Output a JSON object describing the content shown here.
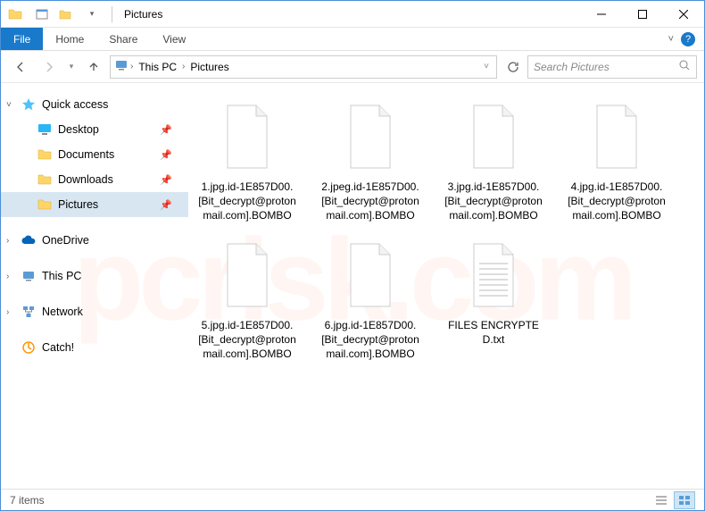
{
  "window": {
    "title": "Pictures",
    "minimize": "—",
    "maximize": "☐",
    "close": "✕"
  },
  "ribbon": {
    "file": "File",
    "home": "Home",
    "share": "Share",
    "view": "View",
    "expand_tip": "^"
  },
  "breadcrumb": {
    "root": "This PC",
    "current": "Pictures"
  },
  "search": {
    "placeholder": "Search Pictures"
  },
  "sidebar": {
    "quick_access": "Quick access",
    "quick_items": [
      {
        "label": "Desktop",
        "icon": "desktop"
      },
      {
        "label": "Documents",
        "icon": "folder"
      },
      {
        "label": "Downloads",
        "icon": "folder"
      },
      {
        "label": "Pictures",
        "icon": "folder"
      }
    ],
    "onedrive": "OneDrive",
    "this_pc": "This PC",
    "network": "Network",
    "catch": "Catch!"
  },
  "files": [
    {
      "name": "1.jpg.id-1E857D00.[Bit_decrypt@protonmail.com].BOMBO",
      "type": "blank"
    },
    {
      "name": "2.jpeg.id-1E857D00.[Bit_decrypt@protonmail.com].BOMBO",
      "type": "blank"
    },
    {
      "name": "3.jpg.id-1E857D00.[Bit_decrypt@protonmail.com].BOMBO",
      "type": "blank"
    },
    {
      "name": "4.jpg.id-1E857D00.[Bit_decrypt@protonmail.com].BOMBO",
      "type": "blank"
    },
    {
      "name": "5.jpg.id-1E857D00.[Bit_decrypt@protonmail.com].BOMBO",
      "type": "blank"
    },
    {
      "name": "6.jpg.id-1E857D00.[Bit_decrypt@protonmail.com].BOMBO",
      "type": "blank"
    },
    {
      "name": "FILES ENCRYPTED.txt",
      "type": "text"
    }
  ],
  "status": {
    "count": "7 items"
  },
  "watermark": "pcrisk.com"
}
